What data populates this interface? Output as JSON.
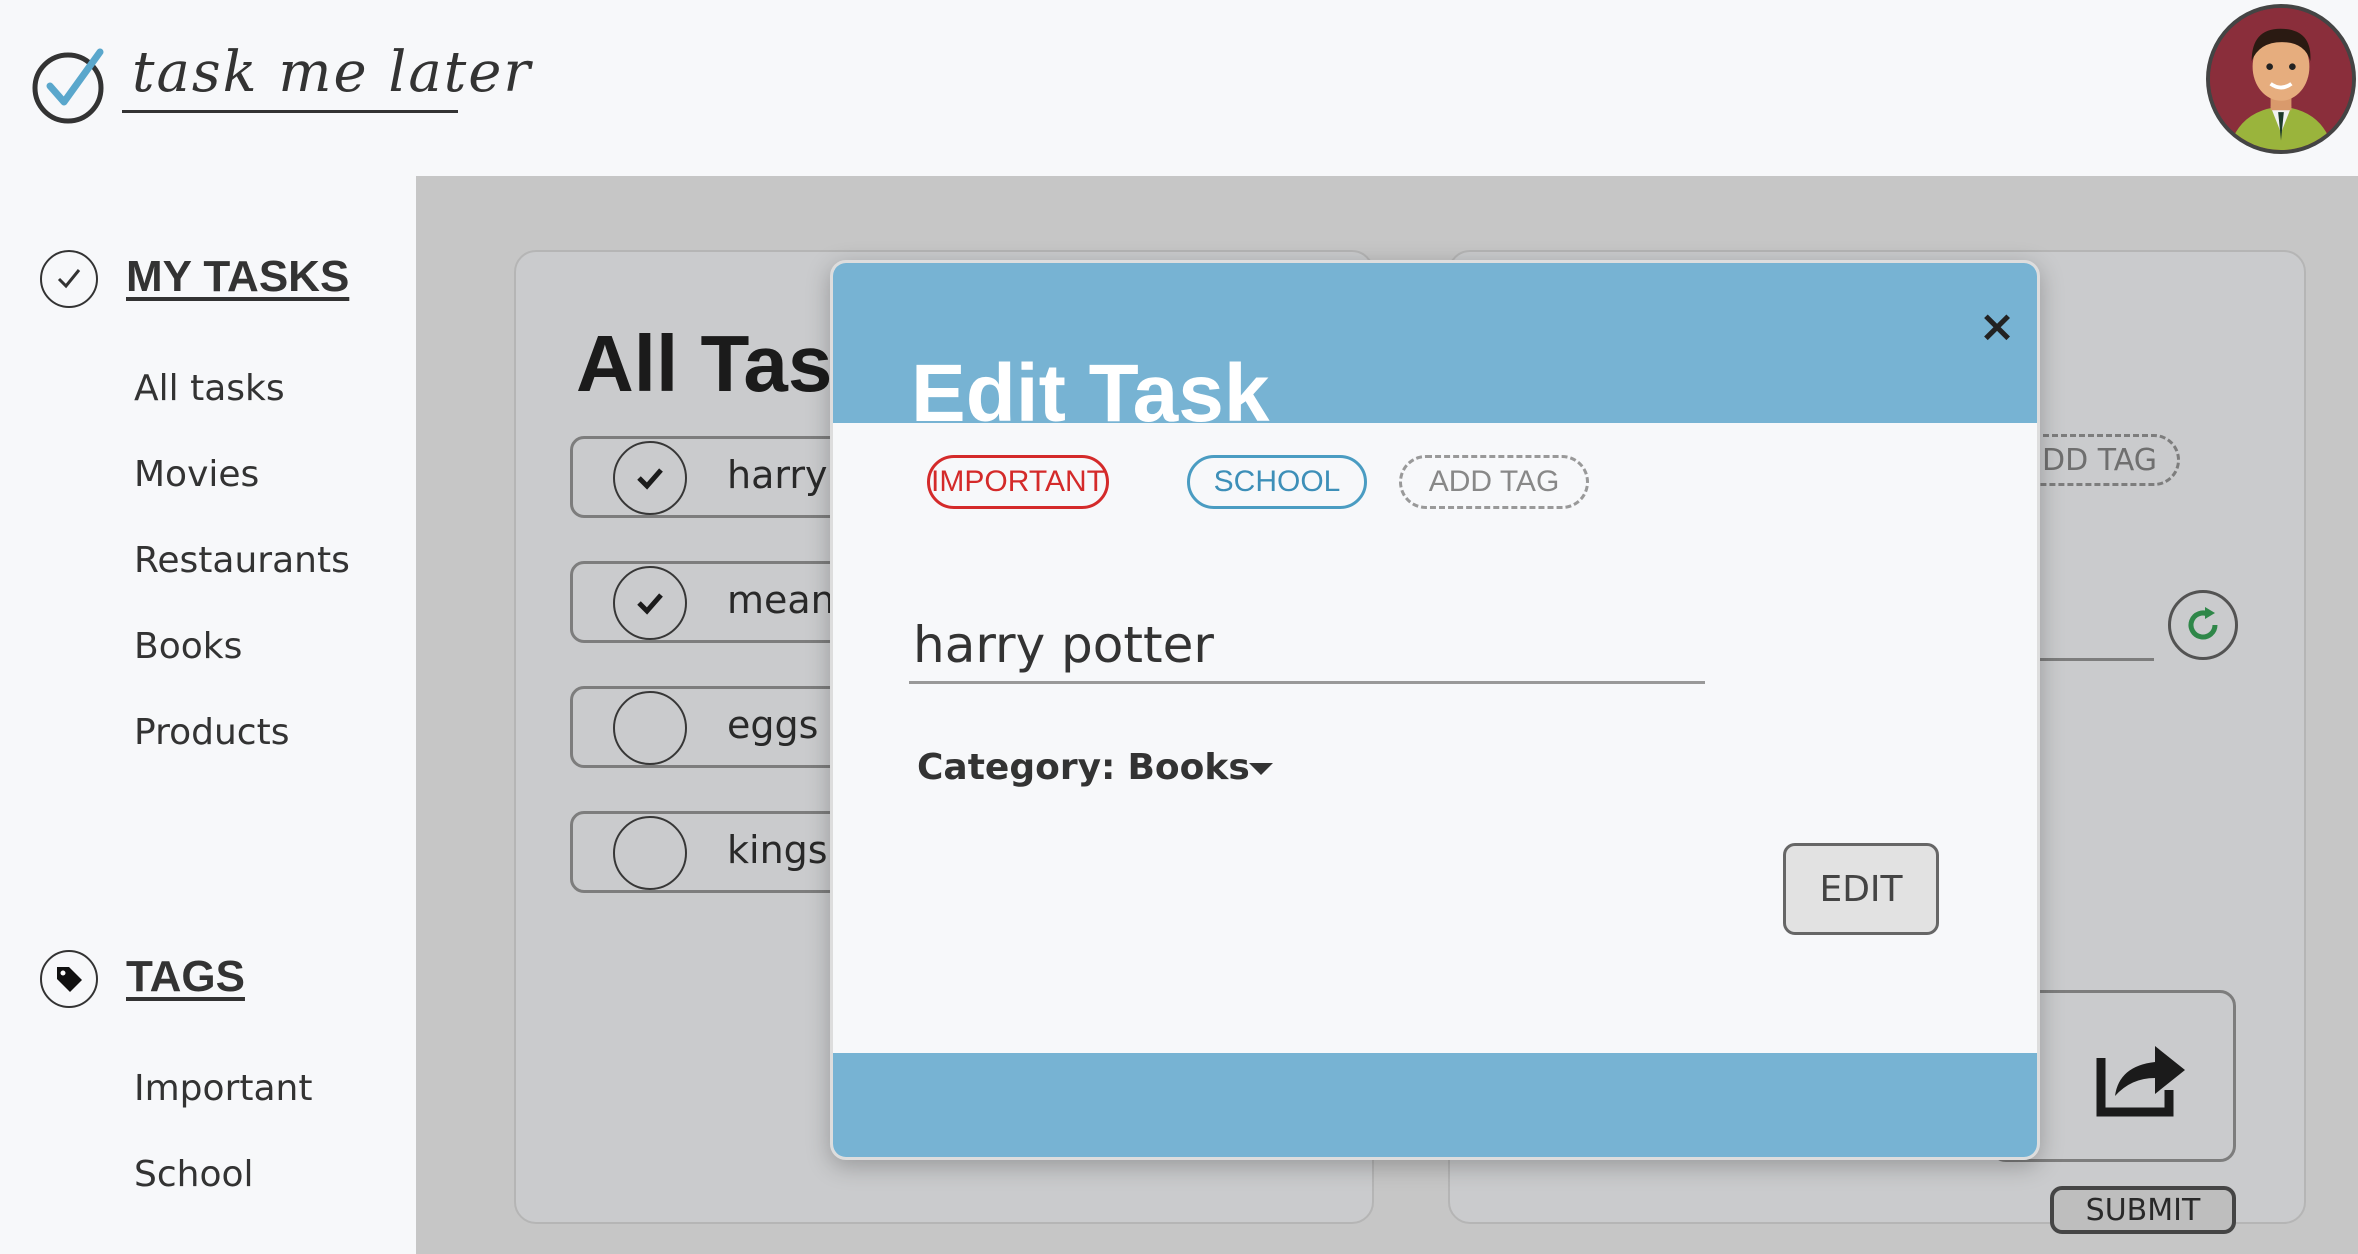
{
  "app": {
    "logo_text": "task me later"
  },
  "sidebar": {
    "tasks_section": {
      "title": "MY TASKS",
      "items": [
        {
          "label": "All tasks"
        },
        {
          "label": "Movies"
        },
        {
          "label": "Restaurants"
        },
        {
          "label": "Books"
        },
        {
          "label": "Products"
        }
      ]
    },
    "tags_section": {
      "title": "TAGS",
      "items": [
        {
          "label": "Important"
        },
        {
          "label": "School"
        }
      ]
    }
  },
  "background": {
    "title_visible": "All Tas",
    "tasks": [
      {
        "label": "harry",
        "checked": true
      },
      {
        "label": "mean",
        "checked": true
      },
      {
        "label": "eggs",
        "checked": false
      },
      {
        "label": "kings",
        "checked": false
      }
    ],
    "add_tag_visible": "DD TAG",
    "submit_label": "SUBMIT"
  },
  "modal": {
    "title": "Edit Task",
    "close_symbol": "×",
    "tags": [
      {
        "label": "IMPORTANT",
        "color": "#d42a2a"
      },
      {
        "label": "SCHOOL",
        "color": "#3d8fb8"
      }
    ],
    "add_tag_label": "ADD TAG",
    "task_name": "harry potter",
    "category_label": "Category:",
    "category_value": "Books",
    "edit_label": "EDIT"
  },
  "colors": {
    "modal_accent": "#77b3d3",
    "important": "#d42a2a",
    "school": "#3d8fb8"
  },
  "icons": {
    "logo": "check-circle-icon",
    "my_tasks": "check-circle-icon",
    "tags": "tag-icon",
    "refresh": "refresh-icon",
    "share": "share-icon",
    "close": "close-icon",
    "caret": "caret-down-icon"
  }
}
